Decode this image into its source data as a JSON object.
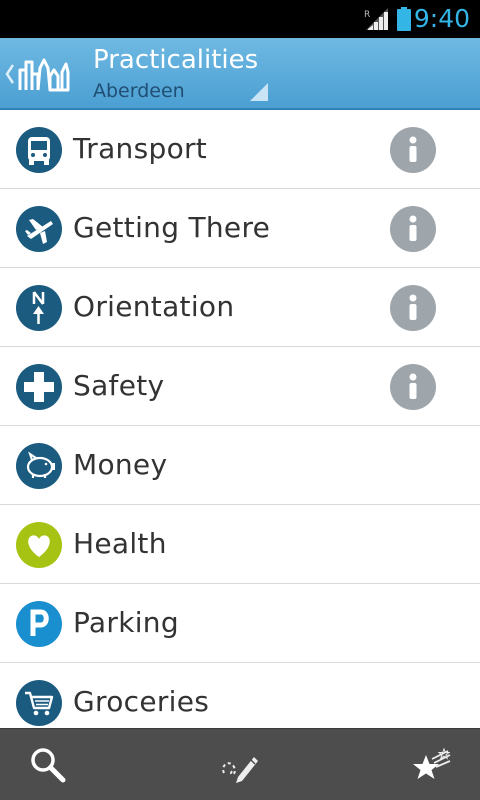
{
  "status_bar": {
    "time": "9:40",
    "roaming_indicator": "R",
    "signal_icon": "signal-icon",
    "battery_icon": "battery-icon",
    "accent_color": "#33b5e5"
  },
  "action_bar": {
    "title": "Practicalities",
    "subtitle": "Aberdeen",
    "up_icon": "chevron-left-icon",
    "logo_icon": "city-skyline-logo-icon",
    "spinner_icon": "dropdown-triangle-icon"
  },
  "list": {
    "items": [
      {
        "label": "Transport",
        "icon": "bus-icon",
        "icon_color": "#1b5b80",
        "has_info": true
      },
      {
        "label": "Getting There",
        "icon": "airplane-icon",
        "icon_color": "#1b5b80",
        "has_info": true
      },
      {
        "label": "Orientation",
        "icon": "compass-north-icon",
        "icon_color": "#1b5b80",
        "has_info": true
      },
      {
        "label": "Safety",
        "icon": "medical-cross-icon",
        "icon_color": "#1b5b80",
        "has_info": true
      },
      {
        "label": "Money",
        "icon": "piggy-bank-icon",
        "icon_color": "#1b5b80",
        "has_info": false
      },
      {
        "label": "Health",
        "icon": "heart-icon",
        "icon_color": "#a6c313",
        "has_info": false
      },
      {
        "label": "Parking",
        "icon": "parking-icon",
        "icon_color": "#1a8fd0",
        "has_info": false
      },
      {
        "label": "Groceries",
        "icon": "shopping-cart-icon",
        "icon_color": "#1b5b80",
        "has_info": false
      }
    ],
    "info_icon": "info-icon",
    "info_color": "#9ea5ab"
  },
  "bottom_bar": {
    "buttons": [
      {
        "icon": "search-icon"
      },
      {
        "icon": "draw-route-icon"
      },
      {
        "icon": "favorites-stars-icon"
      }
    ],
    "background": "#4d4d4d"
  }
}
